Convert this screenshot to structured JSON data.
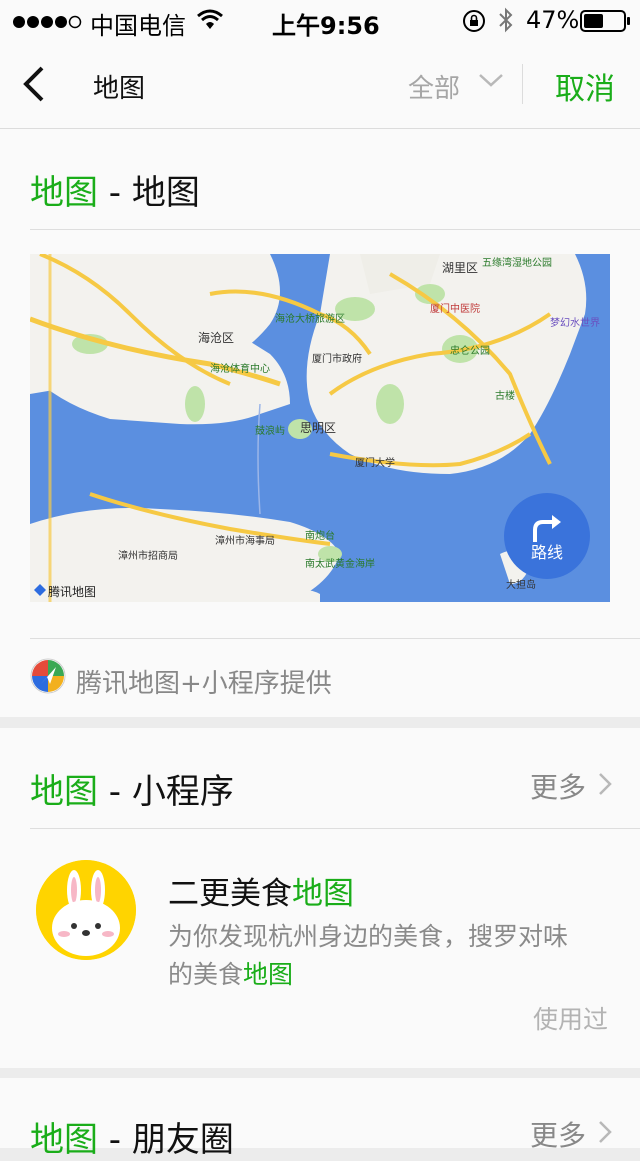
{
  "status_bar": {
    "carrier": "中国电信",
    "time": "上午9:56",
    "battery": "47%"
  },
  "nav": {
    "title": "地图",
    "scope": "全部",
    "cancel": "取消"
  },
  "sections": {
    "map": {
      "keyword": "地图",
      "rest": " - 地图",
      "labels": {
        "haicang": "海沧区",
        "siming": "思明区",
        "huli": "湖里区",
        "zhongshan": "厦门中医院",
        "xmu": "厦门大学",
        "tencent": "腾讯地图",
        "route": "路线",
        "park1": "五缘湾湿地公园",
        "zhongshangongyuan": "忠仑公园",
        "gulangyu": "鼓浪屿",
        "nantaiwu": "南太武黄金海岸",
        "hdshi": "漳州市海事局",
        "zhaoshang": "漳州市招商局",
        "nanhaitai": "南炮台",
        "mengh": "梦幻水世界",
        "gukeng": "古楼",
        "haicangty": "海沧体育中心",
        "shizhengfu": "厦门市政府",
        "haicangq": "海沧大桥旅游区",
        "dadao": "大担岛"
      },
      "provider": "腾讯地图+小程序提供"
    },
    "miniprogram": {
      "keyword": "地图",
      "rest": " - 小程序",
      "more": "更多",
      "app": {
        "name_prefix": "二更美食",
        "name_keyword": "地图",
        "desc_line1": "为你发现杭州身边的美食，搜罗对味",
        "desc_line2_prefix": "的美食",
        "desc_line2_keyword": "地图",
        "used": "使用过"
      }
    },
    "moments": {
      "keyword": "地图",
      "rest": " - 朋友圈",
      "more": "更多"
    }
  },
  "colors": {
    "accent": "#1aad19",
    "sea": "#5b8fe0",
    "route_button": "#3a73db"
  }
}
